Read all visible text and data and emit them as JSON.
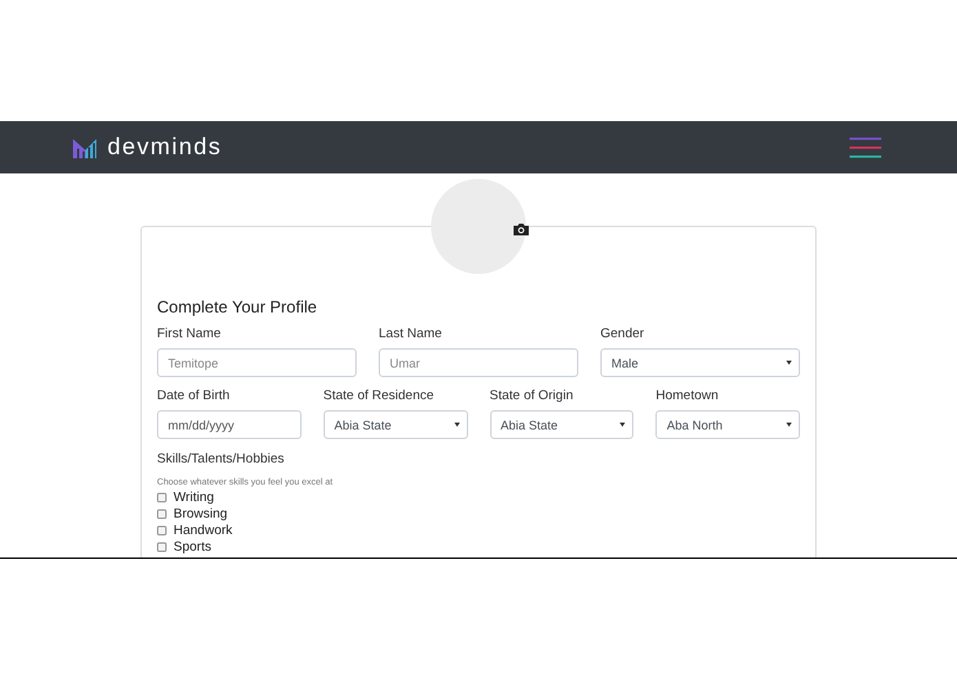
{
  "navbar": {
    "brand": "devminds"
  },
  "profile": {
    "title": "Complete Your Profile",
    "rows": [
      [
        {
          "label": "First Name",
          "kind": "text",
          "placeholder": "Temitope"
        },
        {
          "label": "Last Name",
          "kind": "text",
          "placeholder": "Umar"
        },
        {
          "label": "Gender",
          "kind": "select",
          "value": "Male"
        }
      ],
      [
        {
          "label": "Date of Birth",
          "kind": "date",
          "placeholder": "mm/dd/yyyy"
        },
        {
          "label": "State of Residence",
          "kind": "select",
          "value": "Abia State"
        },
        {
          "label": "State of Origin",
          "kind": "select",
          "value": "Abia State"
        },
        {
          "label": "Hometown",
          "kind": "select",
          "value": "Aba North"
        }
      ]
    ],
    "skills": {
      "label": "Skills/Talents/Hobbies",
      "hint": "Choose whatever skills you feel you excel at",
      "options": [
        {
          "label": "Writing",
          "checked": false
        },
        {
          "label": "Browsing",
          "checked": false
        },
        {
          "label": "Handwork",
          "checked": false
        },
        {
          "label": "Sports",
          "checked": false
        }
      ]
    }
  }
}
